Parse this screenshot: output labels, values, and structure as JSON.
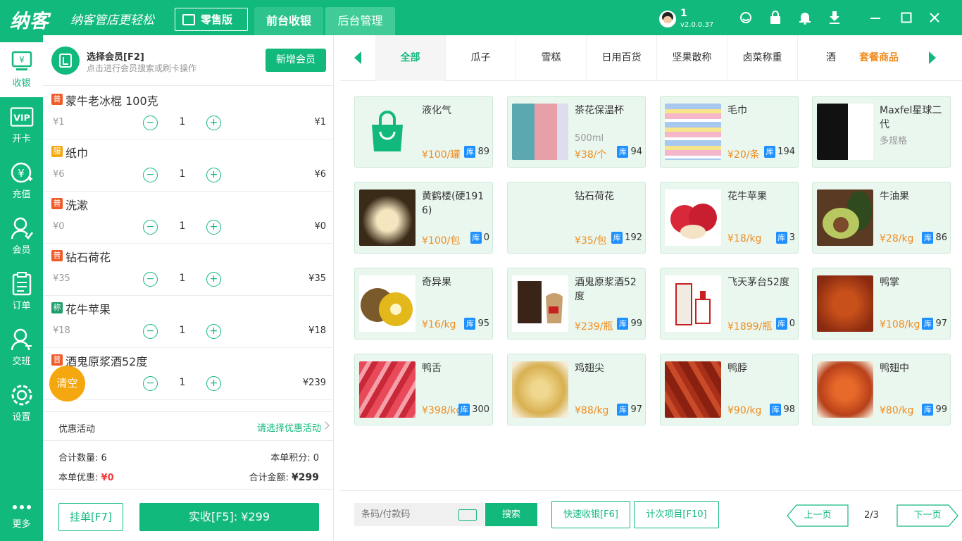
{
  "header": {
    "logo": "纳客",
    "slogan": "纳客管店更轻松",
    "edition": "零售版",
    "tabs": [
      "前台收银",
      "后台管理"
    ],
    "user": {
      "name": "1",
      "version": "v2.0.0.37"
    }
  },
  "sidebar": {
    "items": [
      {
        "label": "收银",
        "icon": "cashier-icon"
      },
      {
        "label": "开卡",
        "icon": "vip-card-icon"
      },
      {
        "label": "充值",
        "icon": "recharge-icon"
      },
      {
        "label": "会员",
        "icon": "member-icon"
      },
      {
        "label": "订单",
        "icon": "order-icon"
      },
      {
        "label": "交班",
        "icon": "shift-icon"
      },
      {
        "label": "设置",
        "icon": "settings-icon"
      },
      {
        "label": "更多",
        "icon": "more-icon"
      }
    ]
  },
  "member": {
    "title": "选择会员[F2]",
    "subtitle": "点击进行会员搜索或刷卡操作",
    "add_button": "新增会员"
  },
  "cart": {
    "items": [
      {
        "tag": "普",
        "name": "蒙牛老冰棍 100克",
        "price": "¥1",
        "qty": "1",
        "subtotal": "¥1"
      },
      {
        "tag": "服",
        "name": "纸巾",
        "price": "¥6",
        "qty": "1",
        "subtotal": "¥6"
      },
      {
        "tag": "普",
        "name": "洗漱",
        "price": "¥0",
        "qty": "1",
        "subtotal": "¥0"
      },
      {
        "tag": "普",
        "name": "钻石荷花",
        "price": "¥35",
        "qty": "1",
        "subtotal": "¥35"
      },
      {
        "tag": "称",
        "name": "花牛苹果",
        "price": "¥18",
        "qty": "1",
        "subtotal": "¥18"
      },
      {
        "tag": "普",
        "name": "酒鬼原浆酒52度",
        "price": "",
        "qty": "1",
        "subtotal": "¥239"
      }
    ],
    "clear_label": "清空"
  },
  "promo": {
    "label": "优惠活动",
    "select": "请选择优惠活动"
  },
  "summary": {
    "qty_label": "合计数量:",
    "qty": "6",
    "points_label": "本单积分:",
    "points": "0",
    "discount_label": "本单优惠:",
    "discount": "¥0",
    "total_label": "合计金额:",
    "total": "¥299"
  },
  "actions": {
    "hold": "挂单[F7]",
    "pay": "实收[F5]: ¥299"
  },
  "categories": [
    "全部",
    "瓜子",
    "雪糕",
    "日用百货",
    "坚果散称",
    "卤菜称重",
    "酒"
  ],
  "category_extra": "套餐商品",
  "products": [
    {
      "name": "液化气",
      "spec": "",
      "price": "¥100/罐",
      "stock": "89"
    },
    {
      "name": "茶花保温杯",
      "spec": "500ml",
      "price": "¥38/个",
      "stock": "94"
    },
    {
      "name": "毛巾",
      "spec": "",
      "price": "¥20/条",
      "stock": "194"
    },
    {
      "name": "Maxfel星球二代",
      "spec": "多规格",
      "price": "",
      "stock": ""
    },
    {
      "name": "黄鹤楼(硬1916)",
      "spec": "",
      "price": "¥100/包",
      "stock": "0"
    },
    {
      "name": "钻石荷花",
      "spec": "",
      "price": "¥35/包",
      "stock": "192"
    },
    {
      "name": "花牛苹果",
      "spec": "",
      "price": "¥18/kg",
      "stock": "3"
    },
    {
      "name": "牛油果",
      "spec": "",
      "price": "¥28/kg",
      "stock": "86"
    },
    {
      "name": "奇异果",
      "spec": "",
      "price": "¥16/kg",
      "stock": "95"
    },
    {
      "name": "酒鬼原浆酒52度",
      "spec": "",
      "price": "¥239/瓶",
      "stock": "99"
    },
    {
      "name": "飞天茅台52度",
      "spec": "",
      "price": "¥1899/瓶",
      "stock": "0"
    },
    {
      "name": "鸭掌",
      "spec": "",
      "price": "¥108/kg",
      "stock": "97"
    },
    {
      "name": "鸭舌",
      "spec": "",
      "price": "¥398/kg",
      "stock": "300"
    },
    {
      "name": "鸡翅尖",
      "spec": "",
      "price": "¥88/kg",
      "stock": "97"
    },
    {
      "name": "鸭脖",
      "spec": "",
      "price": "¥90/kg",
      "stock": "98"
    },
    {
      "name": "鸭翅中",
      "spec": "",
      "price": "¥80/kg",
      "stock": "99"
    }
  ],
  "stock_tag": "库",
  "bottom": {
    "scan_placeholder": "条码/付款码",
    "search": "搜索",
    "quick_cashier": "快速收银[F6]",
    "count_items": "计次项目[F10]",
    "prev": "上一页",
    "page": "2/3",
    "next": "下一页"
  },
  "colors": {
    "brand": "#12b97d",
    "price": "#f08c1e",
    "stock_tag": "#1e90ff",
    "clear": "#f5a70f"
  }
}
